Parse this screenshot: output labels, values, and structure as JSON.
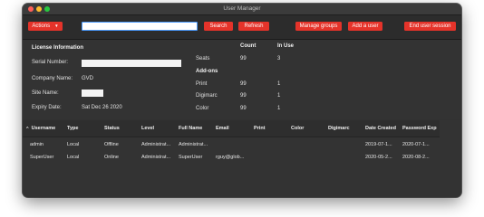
{
  "window": {
    "title": "User Manager"
  },
  "toolbar": {
    "actions_label": "Actions",
    "search_value": "",
    "search_label": "Search",
    "refresh_label": "Refresh",
    "manage_groups_label": "Manage groups",
    "add_user_label": "Add a user",
    "end_session_label": "End user session"
  },
  "license": {
    "heading": "License Information",
    "serial_label": "Serial Number:",
    "company_label": "Company Name:",
    "company_value": "GVD",
    "site_label": "Site Name:",
    "expiry_label": "Expiry Date:",
    "expiry_value": "Sat Dec 26 2020",
    "count_header": "Count",
    "inuse_header": "In Use",
    "seats_label": "Seats",
    "seats_count": "99",
    "seats_inuse": "3",
    "addons_heading": "Add-ons",
    "addons": [
      {
        "name": "Print",
        "count": "99",
        "inuse": "1"
      },
      {
        "name": "Digimarc",
        "count": "99",
        "inuse": "1"
      },
      {
        "name": "Color",
        "count": "99",
        "inuse": "1"
      }
    ]
  },
  "table": {
    "columns": [
      "Username",
      "Type",
      "Status",
      "Level",
      "Full Name",
      "Email",
      "Print",
      "Color",
      "Digimarc",
      "Date Created",
      "Password Exp"
    ],
    "rows": [
      [
        "admin",
        "Local",
        "Offline",
        "Administrat...",
        "Administrat...",
        "",
        "",
        "",
        "",
        "2019-07-1...",
        "2020-07-1..."
      ],
      [
        "SuperUser",
        "Local",
        "Online",
        "Administrat...",
        "SuperUser",
        "rguy@glob...",
        "",
        "",
        "",
        "2020-05-2...",
        "2020-08-2..."
      ]
    ]
  },
  "colors": {
    "accent": "#e5332a",
    "window_bg": "#323232",
    "search_focus": "#4a9bff"
  }
}
